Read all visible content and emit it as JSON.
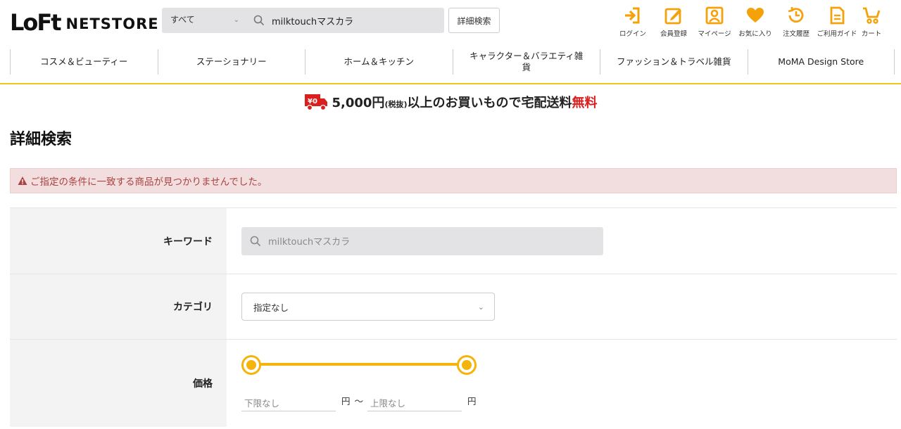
{
  "header": {
    "logo_mark": "LoFt",
    "logo_text": "NETSTORE",
    "search_scope": "すべて",
    "search_query": "milktouchマスカラ",
    "advanced_search_label": "詳細検索",
    "icons": [
      {
        "name": "login-icon",
        "label": "ログイン"
      },
      {
        "name": "register-icon",
        "label": "会員登録"
      },
      {
        "name": "mypage-icon",
        "label": "マイページ"
      },
      {
        "name": "favorite-icon",
        "label": "お気に入り"
      },
      {
        "name": "history-icon",
        "label": "注文履歴"
      },
      {
        "name": "guide-icon",
        "label": "ご利用ガイド"
      },
      {
        "name": "cart-icon",
        "label": "カート"
      }
    ]
  },
  "nav": {
    "items": [
      "コスメ＆ビューティー",
      "ステーショナリー",
      "ホーム＆キッチン",
      "キャラクター＆バラエティ雑貨",
      "ファッション＆トラベル雑貨",
      "MoMA Design Store"
    ]
  },
  "banner": {
    "badge": "¥0",
    "amount": "5,000円",
    "tax": "(税抜)",
    "text": "以上のお買いもので宅配送料",
    "free": "無料"
  },
  "page_title": "詳細検索",
  "alert": {
    "message": "ご指定の条件に一致する商品が見つかりませんでした。"
  },
  "form": {
    "keyword": {
      "label": "キーワード",
      "value": "milktouchマスカラ"
    },
    "category": {
      "label": "カテゴリ",
      "value": "指定なし"
    },
    "price": {
      "label": "価格",
      "min_placeholder": "下限なし",
      "max_placeholder": "上限なし",
      "unit": "円",
      "separator": "～",
      "slider_min_fraction": 0,
      "slider_max_fraction": 1
    }
  },
  "colors": {
    "accent": "#f5b40a",
    "alert_bg": "#f2dede",
    "alert_text": "#a94442",
    "free_red": "#d9201f"
  }
}
